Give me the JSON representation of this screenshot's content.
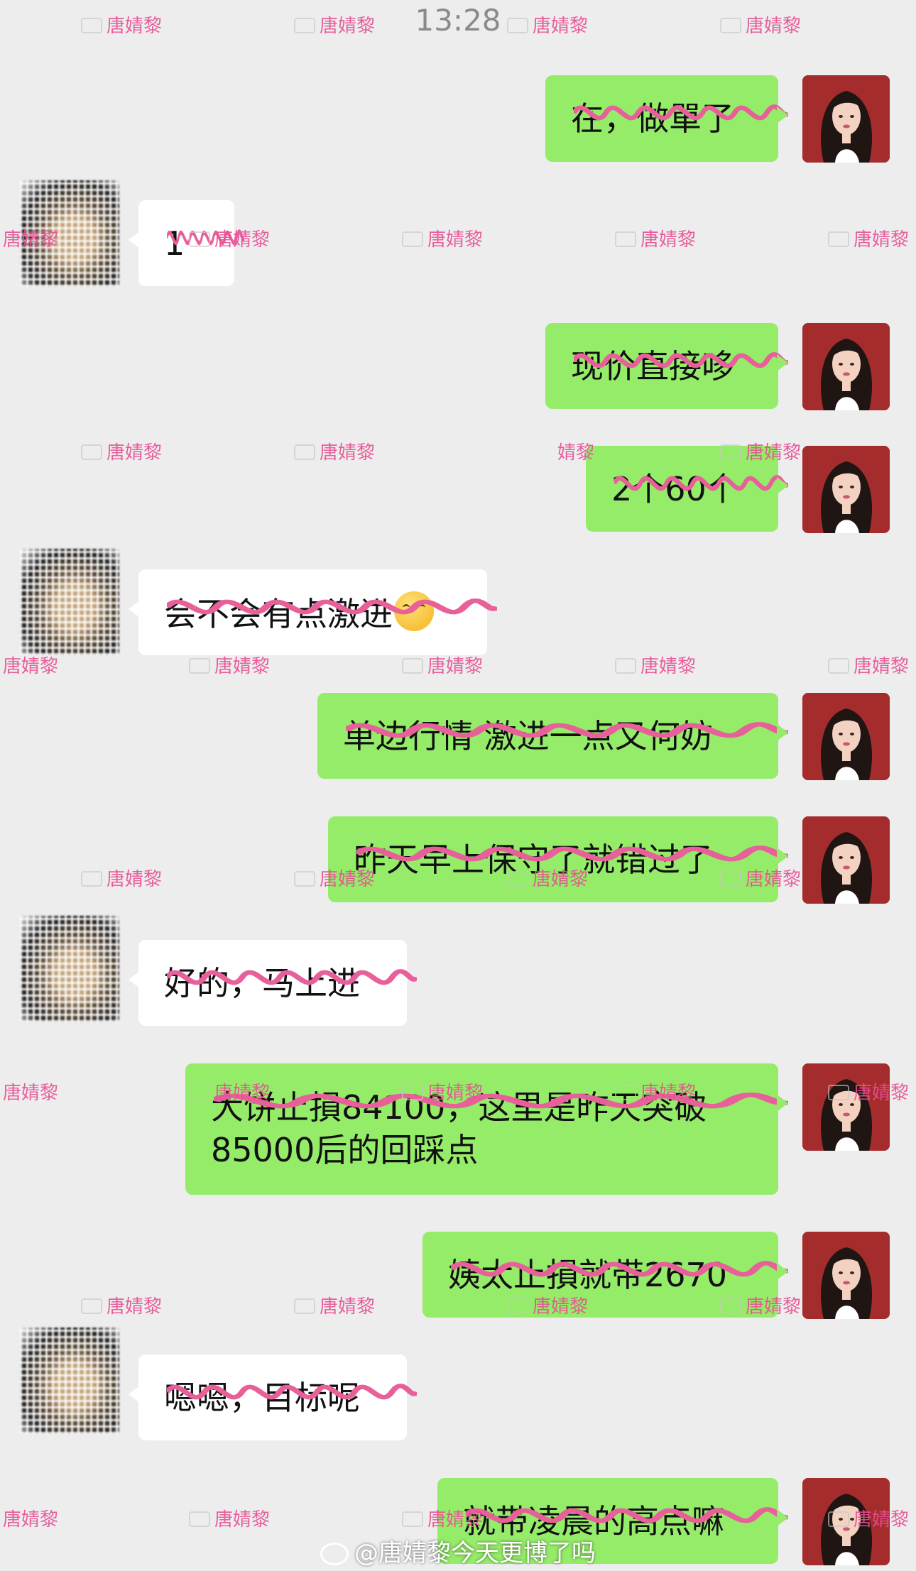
{
  "status_bar": {
    "time": "13:28"
  },
  "watermark": {
    "text": "唐婧黎",
    "partial_text": "婧黎"
  },
  "messages": [
    {
      "side": "right",
      "text": "在，做單了"
    },
    {
      "side": "left",
      "text": "1"
    },
    {
      "side": "right",
      "text": "现价直接哆"
    },
    {
      "side": "right",
      "text": "2个60个"
    },
    {
      "side": "left",
      "text": "会不会有点激进",
      "emoji": "thinking-face-icon"
    },
    {
      "side": "right",
      "text": "单边行情 激进一点又何妨"
    },
    {
      "side": "right",
      "text": "昨天早上保守了就错过了"
    },
    {
      "side": "left",
      "text": "好的，马上进"
    },
    {
      "side": "right",
      "text": "大饼止損84100，这里是昨天突破\n85000后的回踩点"
    },
    {
      "side": "right",
      "text": "姨太止損就带2670"
    },
    {
      "side": "left",
      "text": "嗯嗯，目标呢"
    },
    {
      "side": "right",
      "text": "就带凌晨的高点嘛"
    }
  ],
  "footer": {
    "text": "@唐婧黎今天更博了吗",
    "icon": "weibo-icon"
  },
  "colors": {
    "bubble_right": "#95ec69",
    "bubble_left": "#ffffff",
    "background": "#ededed",
    "watermark": "#e84f95",
    "squiggle": "#e8609a"
  }
}
